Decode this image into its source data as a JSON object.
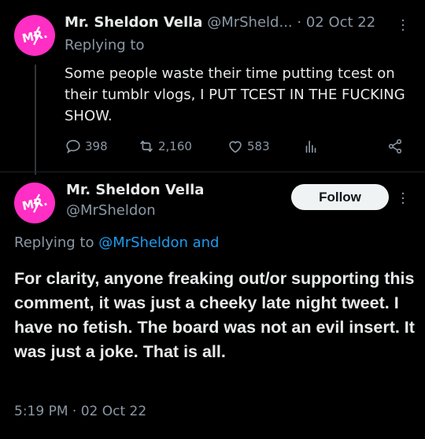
{
  "colors": {
    "accent": "#1d9bf0",
    "avatar_bg": "#ff2ec4",
    "background": "#000000",
    "secondary_text": "#8b98a5"
  },
  "tweet1": {
    "name": "Mr. Sheldon Vella",
    "handle": "@MrSheld...",
    "date": "· 02 Oct 22",
    "replying_to": "Replying to",
    "body": "Some people waste their time putting tcest on their tumblr vlogs, I PUT TCEST IN THE FUCKING SHOW.",
    "stats": {
      "replies": "398",
      "retweets": "2,160",
      "likes": "583"
    },
    "icons": [
      "reply-icon",
      "retweet-icon",
      "like-icon",
      "stats-icon",
      "share-icon",
      "more-icon"
    ]
  },
  "tweet2": {
    "name": "Mr. Sheldon Vella",
    "handle": "@MrSheldon",
    "follow_label": "Follow",
    "replying_prefix": "Replying to ",
    "replying_link": "@MrSheldon and",
    "body": "For clarity, anyone freaking out/or supporting this comment, it was just a cheeky late night tweet. I have no fetish. The board was not an evil insert. It was just a joke. That is all.",
    "timestamp": "5:19 PM · 02 Oct 22"
  }
}
